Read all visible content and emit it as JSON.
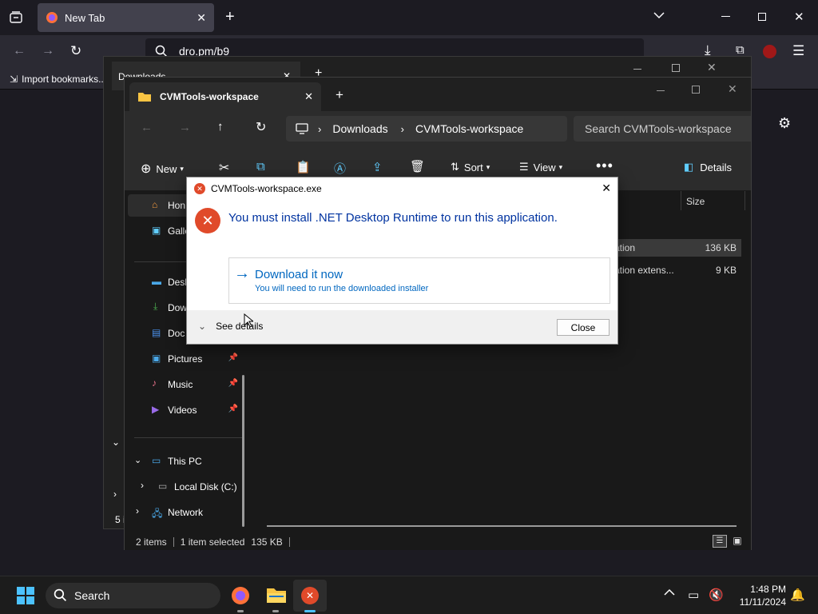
{
  "browser": {
    "tab_title": "New Tab",
    "url": "dro.pm/b9",
    "bookmark_import": "Import bookmarks..."
  },
  "back_window": {
    "tab_title": "Downloads",
    "status_partial": "5 i"
  },
  "explorer": {
    "tab_title": "CVMTools-workspace",
    "breadcrumb": [
      "Downloads",
      "CVMTools-workspace"
    ],
    "search_placeholder": "Search CVMTools-workspace",
    "toolbar": {
      "new_label": "New",
      "sort_label": "Sort",
      "view_label": "View",
      "details_label": "Details"
    },
    "columns": {
      "size": "Size"
    },
    "files": [
      {
        "type_partial": "ation",
        "size": "136 KB",
        "selected": true
      },
      {
        "type_partial": "ation extens...",
        "size": "9 KB",
        "selected": false
      }
    ],
    "nav": {
      "home": "Hon",
      "gallery": "Galle",
      "desktop": "Desk",
      "downloads": "Dow",
      "documents": "Doc",
      "pictures": "Pictures",
      "music": "Music",
      "videos": "Videos",
      "this_pc": "This PC",
      "local_disk": "Local Disk (C:)",
      "network": "Network"
    },
    "status": {
      "items": "2 items",
      "selected": "1 item selected",
      "size": "135 KB"
    }
  },
  "dialog": {
    "title": "CVMTools-workspace.exe",
    "message": "You must install .NET Desktop Runtime to run this application.",
    "download_title": "Download it now",
    "download_subtitle": "You will need to run the downloaded installer",
    "see_details": "See details",
    "close_button": "Close"
  },
  "taskbar": {
    "search_placeholder": "Search",
    "time": "1:48 PM",
    "date": "11/11/2024"
  },
  "colors": {
    "accent_blue": "#0067c0",
    "error_red": "#e04a2a",
    "taskbar_bg": "#1c1c1c"
  }
}
